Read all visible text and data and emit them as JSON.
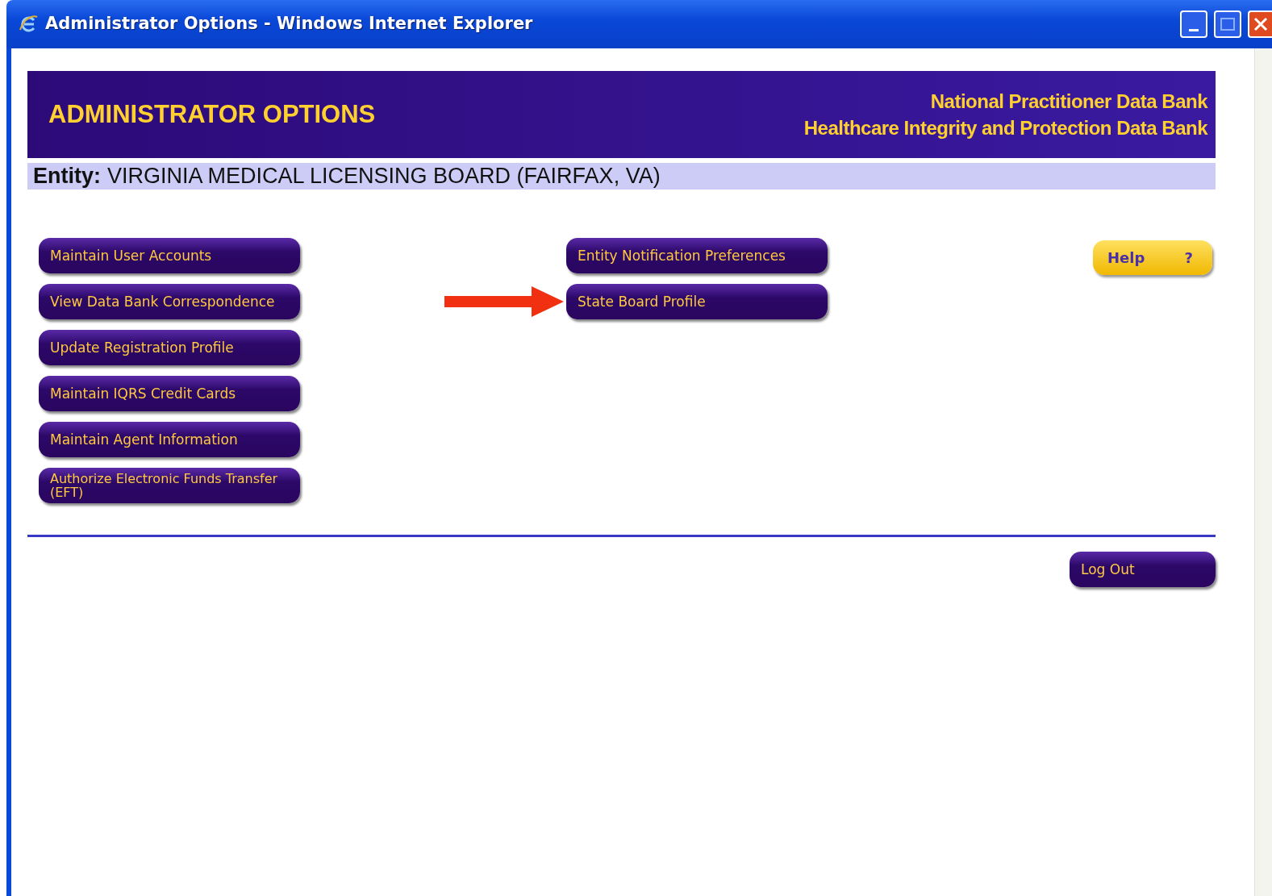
{
  "window": {
    "title": "Administrator Options - Windows Internet Explorer"
  },
  "header": {
    "title": "ADMINISTRATOR OPTIONS",
    "org_lines": [
      "National Practitioner Data Bank",
      "Healthcare Integrity and Protection Data Bank"
    ]
  },
  "entity": {
    "label": "Entity:",
    "value": "VIRGINIA MEDICAL LICENSING BOARD (FAIRFAX, VA)"
  },
  "left_buttons": [
    "Maintain User Accounts",
    "View Data Bank Correspondence",
    "Update Registration Profile",
    "Maintain IQRS Credit Cards",
    "Maintain Agent Information",
    "Authorize Electronic Funds Transfer (EFT)"
  ],
  "middle_buttons": [
    {
      "label": "Entity Notification Preferences",
      "pointed": false
    },
    {
      "label": "State Board Profile",
      "pointed": true
    }
  ],
  "help_button": {
    "label": "Help",
    "glyph": "?"
  },
  "logout_button": {
    "label": "Log Out"
  }
}
